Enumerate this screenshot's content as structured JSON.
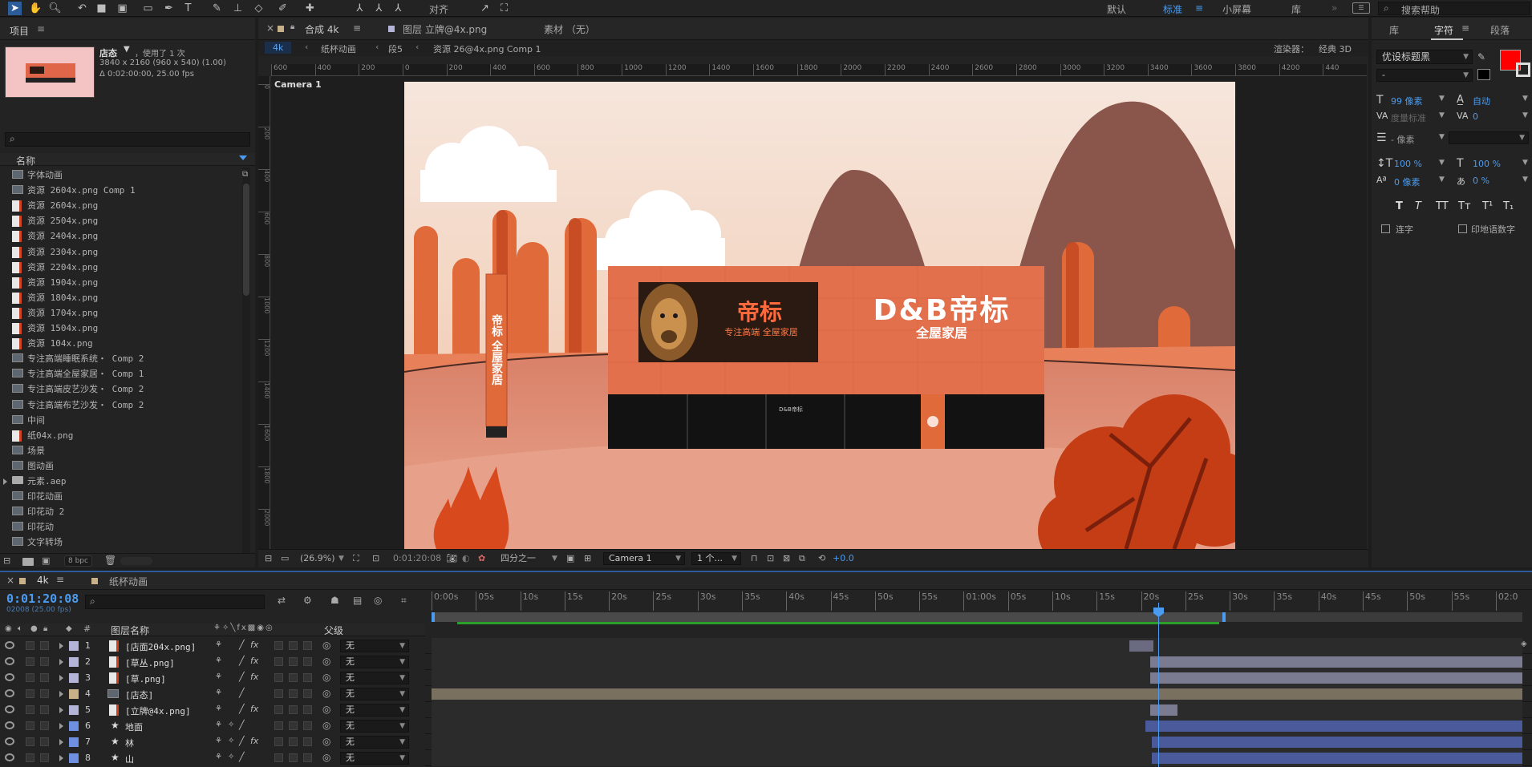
{
  "workspace": {
    "items": [
      "默认",
      "标准",
      "小屏幕",
      "库"
    ],
    "active": "标准",
    "search_placeholder": "搜索帮助",
    "snap_label": "对齐"
  },
  "project": {
    "title": "项目",
    "comp_name": "店态",
    "comp_used": "，使用了 1 次",
    "comp_size": "3840 x 2160 (960 x 540) (1.00)",
    "comp_duration": "Δ 0:02:00:00, 25.00 fps",
    "col_name": "名称",
    "bpc": "8 bpc",
    "items": [
      {
        "name": "字体动画",
        "type": "comp"
      },
      {
        "name": "资源 2604x.png Comp 1",
        "type": "comp"
      },
      {
        "name": "资源 2604x.png",
        "type": "png"
      },
      {
        "name": "资源 2504x.png",
        "type": "png"
      },
      {
        "name": "资源 2404x.png",
        "type": "png"
      },
      {
        "name": "资源 2304x.png",
        "type": "png"
      },
      {
        "name": "资源 2204x.png",
        "type": "png"
      },
      {
        "name": "资源 1904x.png",
        "type": "png"
      },
      {
        "name": "资源 1804x.png",
        "type": "png"
      },
      {
        "name": "资源 1704x.png",
        "type": "png"
      },
      {
        "name": "资源 1504x.png",
        "type": "png"
      },
      {
        "name": "资源 104x.png",
        "type": "png"
      },
      {
        "name": "专注高端睡眠系统・ Comp 2",
        "type": "comp"
      },
      {
        "name": "专注高端全屋家居・ Comp 1",
        "type": "comp"
      },
      {
        "name": "专注高端皮艺沙发・ Comp 2",
        "type": "comp"
      },
      {
        "name": "专注高端布艺沙发・ Comp 2",
        "type": "comp"
      },
      {
        "name": "中间",
        "type": "comp"
      },
      {
        "name": "纸04x.png",
        "type": "png"
      },
      {
        "name": "场景",
        "type": "comp"
      },
      {
        "name": "图动画",
        "type": "comp"
      },
      {
        "name": "元素.aep",
        "type": "folder"
      },
      {
        "name": "印花动画",
        "type": "comp"
      },
      {
        "name": "印花动 2",
        "type": "comp"
      },
      {
        "name": "印花动",
        "type": "comp"
      },
      {
        "name": "文字转场",
        "type": "comp"
      }
    ]
  },
  "composition": {
    "tab_label": "合成 4k",
    "layer_tab": "图层 立牌@4x.png",
    "footage_tab": "素材 （无）",
    "breadcrumbs": [
      "4k",
      "纸杯动画",
      "段5",
      "资源 26@4x.png Comp 1"
    ],
    "renderer_label": "渲染器：",
    "renderer_value": "经典 3D",
    "camera_label": "Camera 1",
    "ruler_ticks": [
      "600",
      "400",
      "200",
      "0",
      "200",
      "400",
      "600",
      "800",
      "1000",
      "1200",
      "1400",
      "1600",
      "1800",
      "2000",
      "2200",
      "2400",
      "2600",
      "2800",
      "3000",
      "3200",
      "3400",
      "3600",
      "3800",
      "4200",
      "440"
    ],
    "vruler_ticks": [
      "0",
      "200",
      "400",
      "600",
      "800",
      "1000",
      "1200",
      "1400",
      "1600",
      "1800",
      "2000"
    ],
    "zoom": "(26.9%)",
    "timecode": "0:01:20:08",
    "resolution": "四分之一",
    "camera_select": "Camera 1",
    "views": "1 个...",
    "exposure": "+0.0"
  },
  "scene": {
    "brand_en": "D&B帝标",
    "brand_sub": "全屋家居",
    "banner_title": "帝标",
    "banner_sub": "专注高端 全屋家居",
    "pillar_text": "帝标 全屋家居",
    "door_sign": "D&B帝标"
  },
  "character": {
    "tabs": [
      "库",
      "字符",
      "段落"
    ],
    "font": "优设标题黑",
    "style": "-",
    "size": "99 像素",
    "leading": "自动",
    "kerning": "度量标准",
    "tracking": "0",
    "stroke": "- 像素",
    "vscale": "100 %",
    "hscale": "100 %",
    "baseline": "0 像素",
    "tsume": "0 %",
    "style_buttons": [
      "T",
      "T",
      "TT",
      "Tт",
      "T¹",
      "T₁"
    ],
    "ligature": "连字",
    "hindi_digits": "印地语数字",
    "fill_color": "#ff0000"
  },
  "timeline": {
    "tab_label": "4k",
    "tab2_label": "纸杯动画",
    "timecode": "0:01:20:08",
    "frames": "02008 (25.00 fps)",
    "col_layer_name": "图层名称",
    "col_parent": "父级",
    "col_num": "#",
    "time_ticks": [
      "0:00s",
      "05s",
      "10s",
      "15s",
      "20s",
      "25s",
      "30s",
      "35s",
      "40s",
      "45s",
      "50s",
      "55s",
      "01:00s",
      "05s",
      "10s",
      "15s",
      "20s",
      "25s",
      "30s",
      "35s",
      "40s",
      "45s",
      "50s",
      "55s",
      "02:0"
    ],
    "layers": [
      {
        "num": "1",
        "name": "[店面204x.png]",
        "type": "png",
        "color": "#b4b4d8",
        "parent": "无",
        "fx": true,
        "bar_color": "#6a6a80"
      },
      {
        "num": "2",
        "name": "[草丛.png]",
        "type": "png",
        "color": "#b4b4d8",
        "parent": "无",
        "fx": true,
        "bar_color": "#7a7a90"
      },
      {
        "num": "3",
        "name": "[草.png]",
        "type": "png",
        "color": "#b4b4d8",
        "parent": "无",
        "fx": true,
        "bar_color": "#7a7a90"
      },
      {
        "num": "4",
        "name": "[店态]",
        "type": "comp",
        "color": "#c8b088",
        "parent": "无",
        "fx": false,
        "bar_color": "#7a7060"
      },
      {
        "num": "5",
        "name": "[立牌@4x.png]",
        "type": "png",
        "color": "#b4b4d8",
        "parent": "无",
        "fx": true,
        "bar_color": "#7a7a90"
      },
      {
        "num": "6",
        "name": "地面",
        "type": "shape",
        "color": "#6f8fe0",
        "parent": "无",
        "fx": false,
        "bar_color": "#4a5a9a"
      },
      {
        "num": "7",
        "name": "林",
        "type": "shape",
        "color": "#6f8fe0",
        "parent": "无",
        "fx": true,
        "bar_color": "#4a5a9a"
      },
      {
        "num": "8",
        "name": "山",
        "type": "shape",
        "color": "#6f8fe0",
        "parent": "无",
        "fx": false,
        "bar_color": "#4a5a9a"
      }
    ]
  }
}
